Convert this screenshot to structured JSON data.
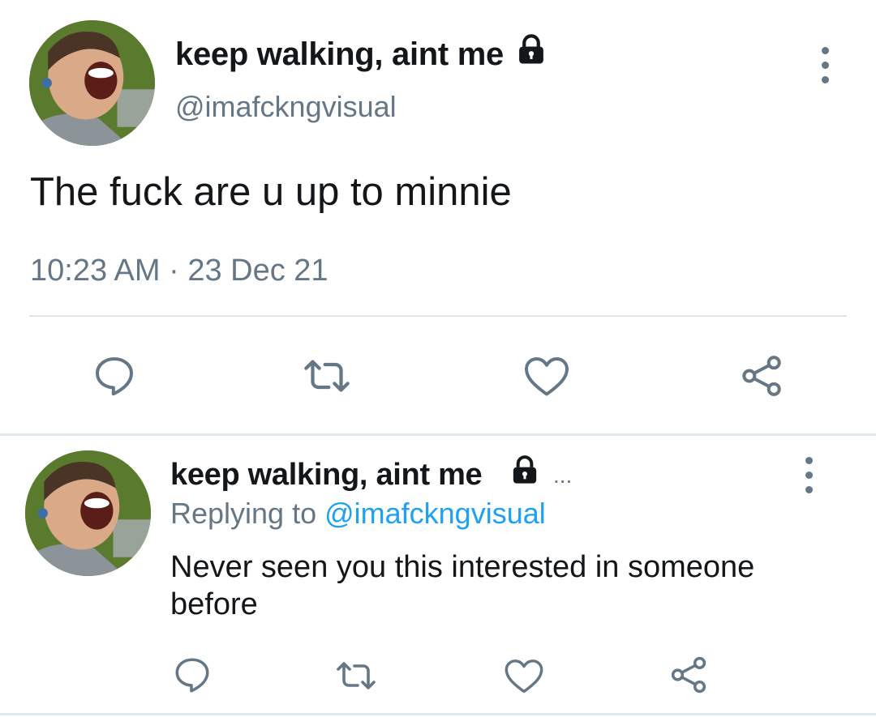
{
  "main_tweet": {
    "display_name": "keep walking, aint me",
    "handle": "@imafckngvisual",
    "text": "The fuck are u up to minnie",
    "timestamp": "10:23 AM · 23 Dec 21"
  },
  "reply_tweet": {
    "display_name": "keep walking, aint me",
    "ellipsis": "...",
    "replying_prefix": "Replying to ",
    "replying_handle": "@imafckngvisual",
    "text": "Never seen you this interested in someone before"
  },
  "icons": {
    "protected": "lock-icon",
    "more": "more-options-icon",
    "reply": "comment-icon",
    "retweet": "retweet-icon",
    "like": "heart-icon",
    "share": "share-icon"
  },
  "colors": {
    "text": "#14171a",
    "secondary": "#657786",
    "link": "#1da1f2",
    "divider": "#e1e8ed"
  }
}
